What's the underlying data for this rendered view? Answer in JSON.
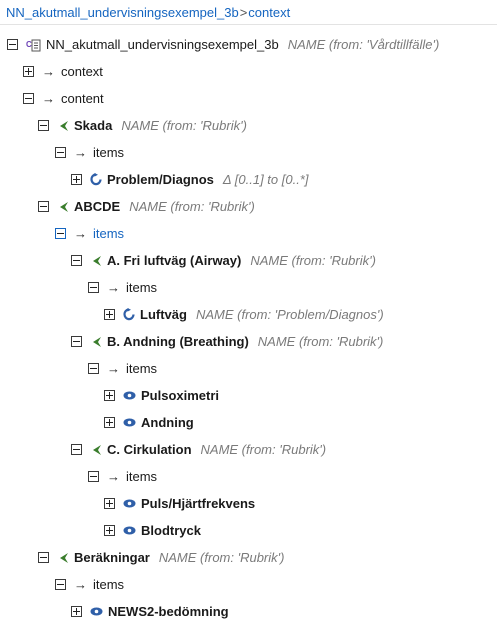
{
  "breadcrumb": {
    "root": "NN_akutmall_undervisningsexempel_3b",
    "separator": ">",
    "current": "context"
  },
  "tree": {
    "root": {
      "label": "NN_akutmall_undervisningsexempel_3b",
      "meta": "NAME (from: 'Vårdtillfälle')"
    },
    "context": {
      "label": "context"
    },
    "content": {
      "label": "content"
    },
    "skada": {
      "label": "Skada",
      "meta": "NAME (from: 'Rubrik')"
    },
    "skada_items": {
      "label": "items"
    },
    "problem": {
      "label": "Problem/Diagnos",
      "meta": "Δ [0..1] to [0..*]"
    },
    "abcde": {
      "label": "ABCDE",
      "meta": "NAME (from: 'Rubrik')"
    },
    "abcde_items": {
      "label": "items"
    },
    "airway": {
      "label": "A. Fri luftväg (Airway)",
      "meta": "NAME (from: 'Rubrik')"
    },
    "airway_items": {
      "label": "items"
    },
    "luftvag": {
      "label": "Luftväg",
      "meta": "NAME (from: 'Problem/Diagnos')"
    },
    "breathing": {
      "label": "B. Andning (Breathing)",
      "meta": "NAME (from: 'Rubrik')"
    },
    "breathing_items": {
      "label": "items"
    },
    "pulsoximetri": {
      "label": "Pulsoximetri"
    },
    "andning": {
      "label": "Andning"
    },
    "circulation": {
      "label": "C. Cirkulation",
      "meta": "NAME (from: 'Rubrik')"
    },
    "circulation_items": {
      "label": "items"
    },
    "puls": {
      "label": "Puls/Hjärtfrekvens"
    },
    "blodtryck": {
      "label": "Blodtryck"
    },
    "berakningar": {
      "label": "Beräkningar",
      "meta": "NAME (from: 'Rubrik')"
    },
    "berakningar_items": {
      "label": "items"
    },
    "news2": {
      "label": "NEWS2-bedömning"
    }
  },
  "icons": {
    "toggle_expanded": "minus-box",
    "toggle_collapsed": "plus-box",
    "attribute": "right-arrow",
    "section": "green-chevron",
    "evaluation": "blue-cycle",
    "observation": "blue-eye",
    "composition": "document"
  },
  "colors": {
    "link": "#1565c0",
    "meta": "#7a7a7a",
    "section_icon": "#3a7d2c",
    "entry_icon": "#2f5fa8"
  }
}
